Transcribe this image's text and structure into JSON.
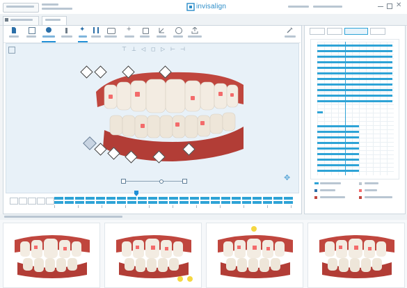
{
  "header": {
    "logo": "invisalign",
    "logo_color": "#2a8cc8"
  },
  "colors": {
    "accent": "#1f8fd6",
    "gum": "#c0463e",
    "tooth": "#f3ece2",
    "attachment": "#f36b6b",
    "chart_bar": "#2ea3d6",
    "panel_bg": "#e6f0f7"
  }
}
